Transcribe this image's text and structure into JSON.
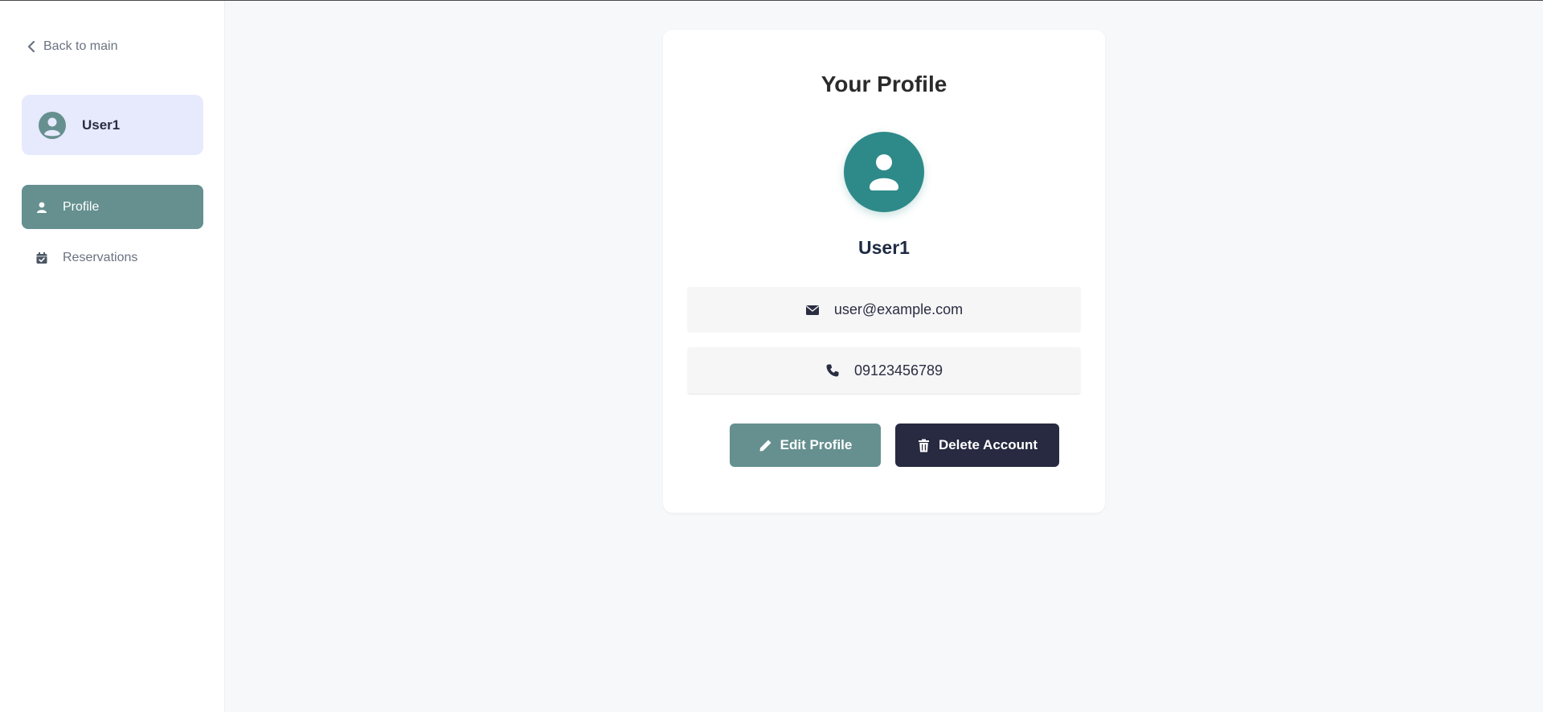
{
  "sidebar": {
    "back_label": "Back to main",
    "user_name": "User1",
    "nav": [
      {
        "label": "Profile",
        "icon": "user-icon",
        "active": true
      },
      {
        "label": "Reservations",
        "icon": "calendar-check-icon",
        "active": false
      }
    ]
  },
  "profile": {
    "title": "Your Profile",
    "name": "User1",
    "email": "user@example.com",
    "phone": "09123456789",
    "edit_label": "Edit Profile",
    "delete_label": "Delete Account"
  },
  "colors": {
    "accent": "#65908f",
    "avatar": "#2e8a89",
    "danger_button": "#272a40",
    "user_card_bg": "#e7e9fd"
  }
}
